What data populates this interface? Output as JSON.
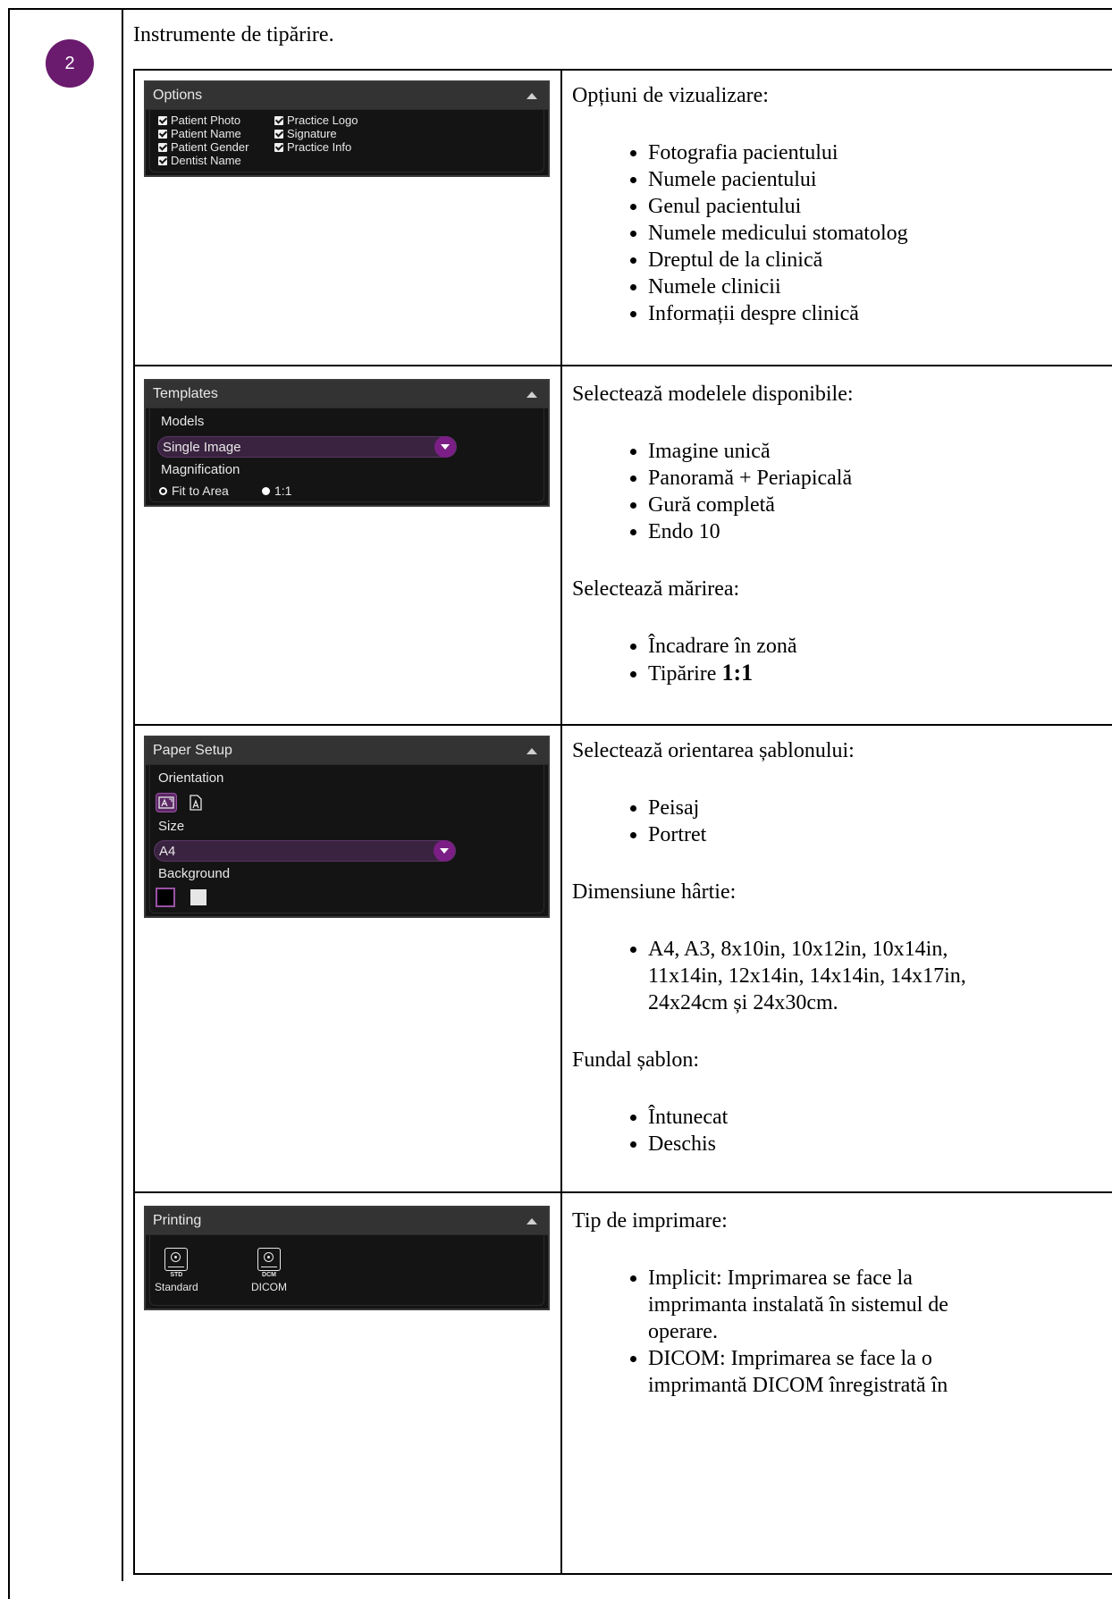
{
  "step_number": "2",
  "section_title": "Instrumente de tipărire.",
  "options_panel": {
    "title": "Options",
    "checkboxes": [
      "Patient Photo",
      "Practice Logo",
      "Patient Name",
      "Signature",
      "Patient Gender",
      "Practice Info",
      "Dentist Name"
    ]
  },
  "options_desc": {
    "intro": "Opțiuni de vizualizare:",
    "items": [
      "Fotografia pacientului",
      "Numele pacientului",
      "Genul pacientului",
      "Numele medicului stomatolog",
      "Dreptul de la clinică",
      "Numele clinicii",
      "Informații despre clinică"
    ]
  },
  "templates_panel": {
    "title": "Templates",
    "models_label": "Models",
    "models_value": "Single Image",
    "magnification_label": "Magnification",
    "radio_fit": "Fit to Area",
    "radio_one": "1:1"
  },
  "templates_desc": {
    "intro_models": "Selectează modelele disponibile:",
    "models": [
      "Imagine unică",
      "Panoramă + Periapicală",
      "Gură completă",
      "Endo 10"
    ],
    "intro_mag": "Selectează mărirea:",
    "mag_item1": "Încadrare în zonă",
    "mag_item2_prefix": "Tipărire ",
    "mag_item2_bold": "1:1"
  },
  "paper_panel": {
    "title": "Paper Setup",
    "orientation_label": "Orientation",
    "size_label": "Size",
    "size_value": "A4",
    "background_label": "Background"
  },
  "paper_desc": {
    "intro_orient": "Selectează orientarea șablonului:",
    "orient_items": [
      "Peisaj",
      "Portret"
    ],
    "intro_size": "Dimensiune hârtie:",
    "size_item": "A4, A3, 8x10in, 10x12in, 10x14in, 11x14in, 12x14in, 14x14in, 14x17in, 24x24cm și 24x30cm.",
    "intro_bg": "Fundal șablon:",
    "bg_items": [
      "Întunecat",
      "Deschis"
    ]
  },
  "printing_panel": {
    "title": "Printing",
    "std_tag": "STD",
    "std_label": "Standard",
    "dcm_tag": "DCM",
    "dcm_label": "DICOM"
  },
  "printing_desc": {
    "intro": "Tip de imprimare:",
    "items": [
      "Implicit: Imprimarea se face la imprimanta instalată în sistemul de operare.",
      "DICOM: Imprimarea se face la o imprimantă DICOM înregistrată în"
    ]
  },
  "colors": {
    "badge": "#6a1b6e",
    "panel_bg": "#141414",
    "panel_header": "#333333",
    "accent_purple": "#7b1f86"
  }
}
